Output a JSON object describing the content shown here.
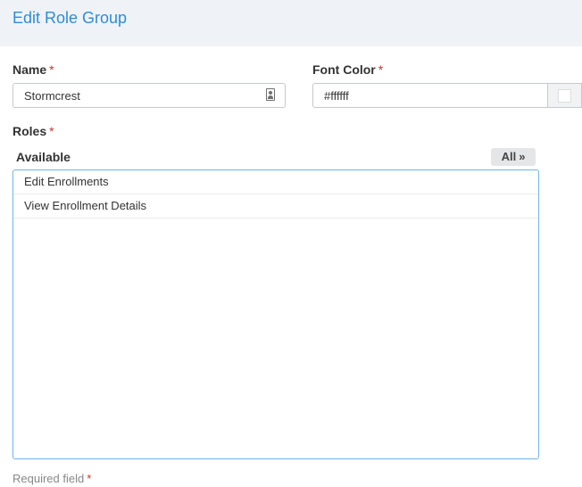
{
  "header": {
    "title": "Edit Role Group"
  },
  "form": {
    "name_label": "Name",
    "name_value": "Stormcrest",
    "font_color_label": "Font Color",
    "font_color_value": "#ffffff",
    "font_color_swatch": "#ffffff",
    "roles_label": "Roles",
    "required_mark": "*"
  },
  "roles": {
    "available_label": "Available",
    "all_button_label": "All",
    "all_button_icon": "»",
    "available_items": [
      {
        "label": "Edit Enrollments"
      },
      {
        "label": "View Enrollment Details"
      }
    ]
  },
  "footer": {
    "required_note": "Required field",
    "required_mark": "*"
  },
  "colors": {
    "accent": "#2d8dd8",
    "required": "#c0392b"
  }
}
